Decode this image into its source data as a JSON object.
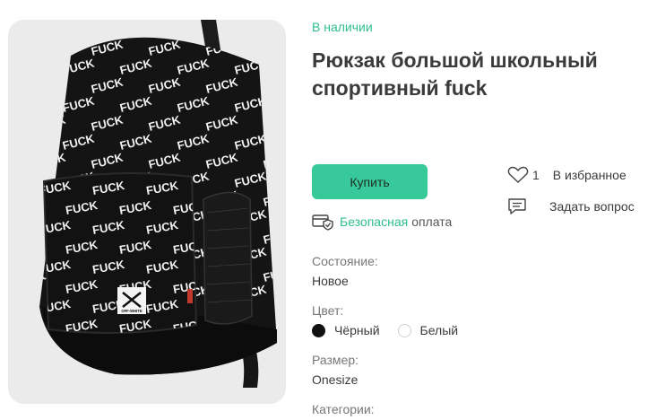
{
  "product": {
    "availability": "В наличии",
    "title": "Рюкзак большой школьный спортивный fuck",
    "image_print_word": "FUCK",
    "image_badge_text": "OFF-WHITE"
  },
  "actions": {
    "buy_label": "Купить",
    "favorite_count": "1",
    "favorite_label": "В избранное",
    "ask_label": "Задать вопрос"
  },
  "safe_payment": {
    "link_text": "Безопасная",
    "rest_text": "оплата"
  },
  "properties": {
    "condition_label": "Состояние:",
    "condition_value": "Новое",
    "color_label": "Цвет:",
    "colors": [
      {
        "name": "Чёрный",
        "swatch": "#111111"
      },
      {
        "name": "Белый",
        "swatch": "#ffffff"
      }
    ],
    "size_label": "Размер:",
    "size_value": "Onesize",
    "categories_label": "Категории:"
  },
  "theme": {
    "accent": "#2fbe8f",
    "button": "#37c99a"
  }
}
